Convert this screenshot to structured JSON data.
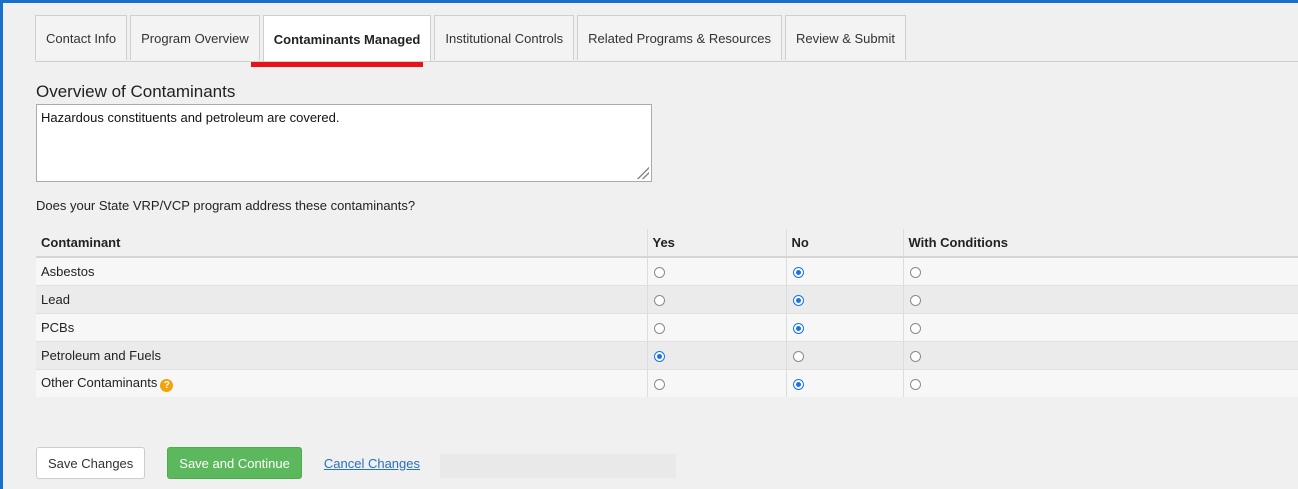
{
  "tabs": [
    {
      "label": "Contact Info",
      "active": false
    },
    {
      "label": "Program Overview",
      "active": false
    },
    {
      "label": "Contaminants Managed",
      "active": true
    },
    {
      "label": "Institutional Controls",
      "active": false
    },
    {
      "label": "Related Programs & Resources",
      "active": false
    },
    {
      "label": "Review & Submit",
      "active": false
    }
  ],
  "overview": {
    "title": "Overview of Contaminants",
    "text": "Hazardous constituents and petroleum are covered."
  },
  "question": "Does your State VRP/VCP program address these contaminants?",
  "table": {
    "headers": [
      "Contaminant",
      "Yes",
      "No",
      "With Conditions"
    ],
    "rows": [
      {
        "name": "Asbestos",
        "selected": "No",
        "help": false
      },
      {
        "name": "Lead",
        "selected": "No",
        "help": false
      },
      {
        "name": "PCBs",
        "selected": "No",
        "help": false
      },
      {
        "name": "Petroleum and Fuels",
        "selected": "Yes",
        "help": false
      },
      {
        "name": "Other Contaminants",
        "selected": "No",
        "help": true
      }
    ]
  },
  "help_icon_glyph": "?",
  "buttons": {
    "save": "Save Changes",
    "save_continue": "Save and Continue",
    "cancel": "Cancel Changes"
  },
  "colors": {
    "accent_border": "#1a6fc9",
    "active_tab_underline": "#e8121b",
    "radio_checked": "#1a73e8",
    "primary_button": "#5cb85c",
    "help_icon": "#f0a30a",
    "link": "#2a6fc1"
  }
}
